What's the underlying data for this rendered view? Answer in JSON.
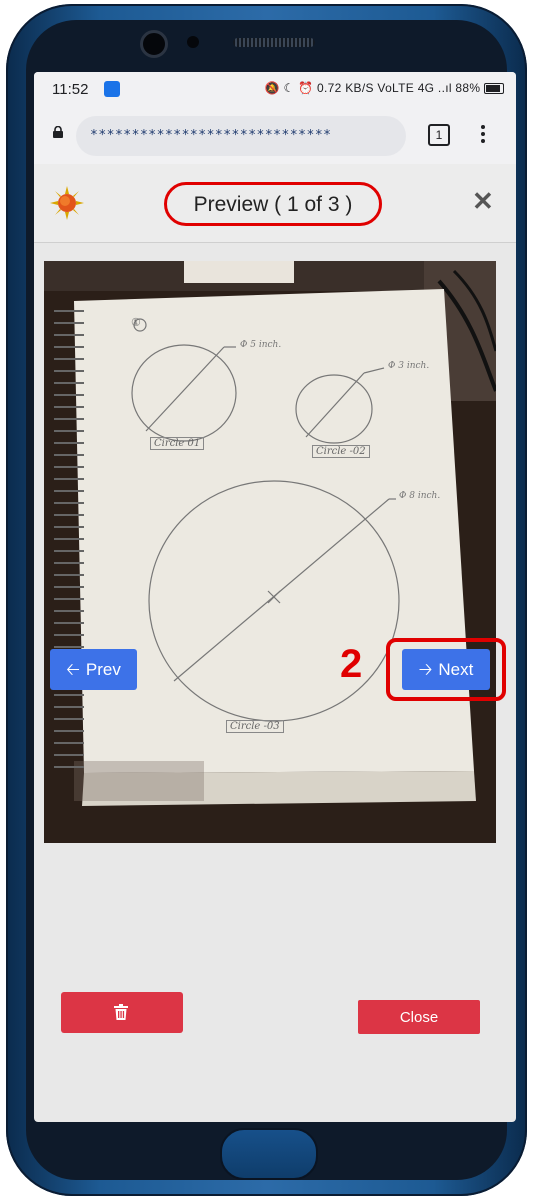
{
  "status_bar": {
    "time": "11:52",
    "indicators": "🔕 ☾ ⏰ 0.72 KB/S VoLTE 4G ..ıl 88%",
    "battery_percent": "88%"
  },
  "browser": {
    "url": "*****************************",
    "tab_count": "1"
  },
  "modal": {
    "title": "Preview ( 1 of 3 )",
    "close_symbol": "✕",
    "logo_icon": "sun-icon"
  },
  "photo": {
    "labels": [
      "Circle 01",
      "Circle -02",
      "Circle -03"
    ],
    "page_number": "①",
    "annotations": [
      "Φ 5 inch.",
      "Φ 3 inch.",
      "Φ 8 inch."
    ]
  },
  "navigation": {
    "prev_label": "Prev",
    "next_label": "Next",
    "prev_icon": "arrow-left-icon",
    "next_icon": "arrow-right-icon",
    "step_number": "2"
  },
  "footer": {
    "delete_icon": "trash-icon",
    "close_label": "Close"
  },
  "colors": {
    "primary": "#3d72e8",
    "danger": "#dc3545",
    "highlight": "#e00000"
  }
}
